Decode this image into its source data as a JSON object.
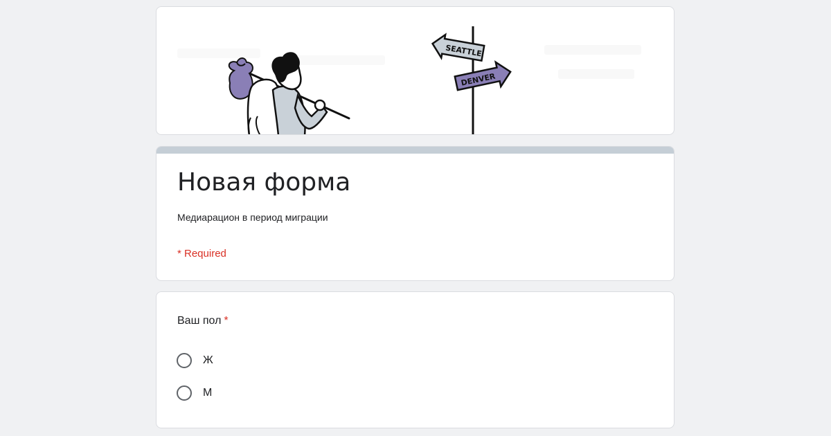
{
  "banner": {
    "sign_top": "SEATTLE",
    "sign_bottom": "DENVER"
  },
  "header": {
    "title": "Новая форма",
    "description": "Медиарацион в период миграции",
    "required_note": "* Required"
  },
  "question": {
    "title": "Ваш пол",
    "required_mark": "*",
    "options": [
      {
        "label": "Ж"
      },
      {
        "label": "М"
      }
    ]
  },
  "colors": {
    "background": "#f0f1f3",
    "header_accent": "#c5ced6",
    "required": "#d93025",
    "bag_purple": "#8a7fb6"
  }
}
